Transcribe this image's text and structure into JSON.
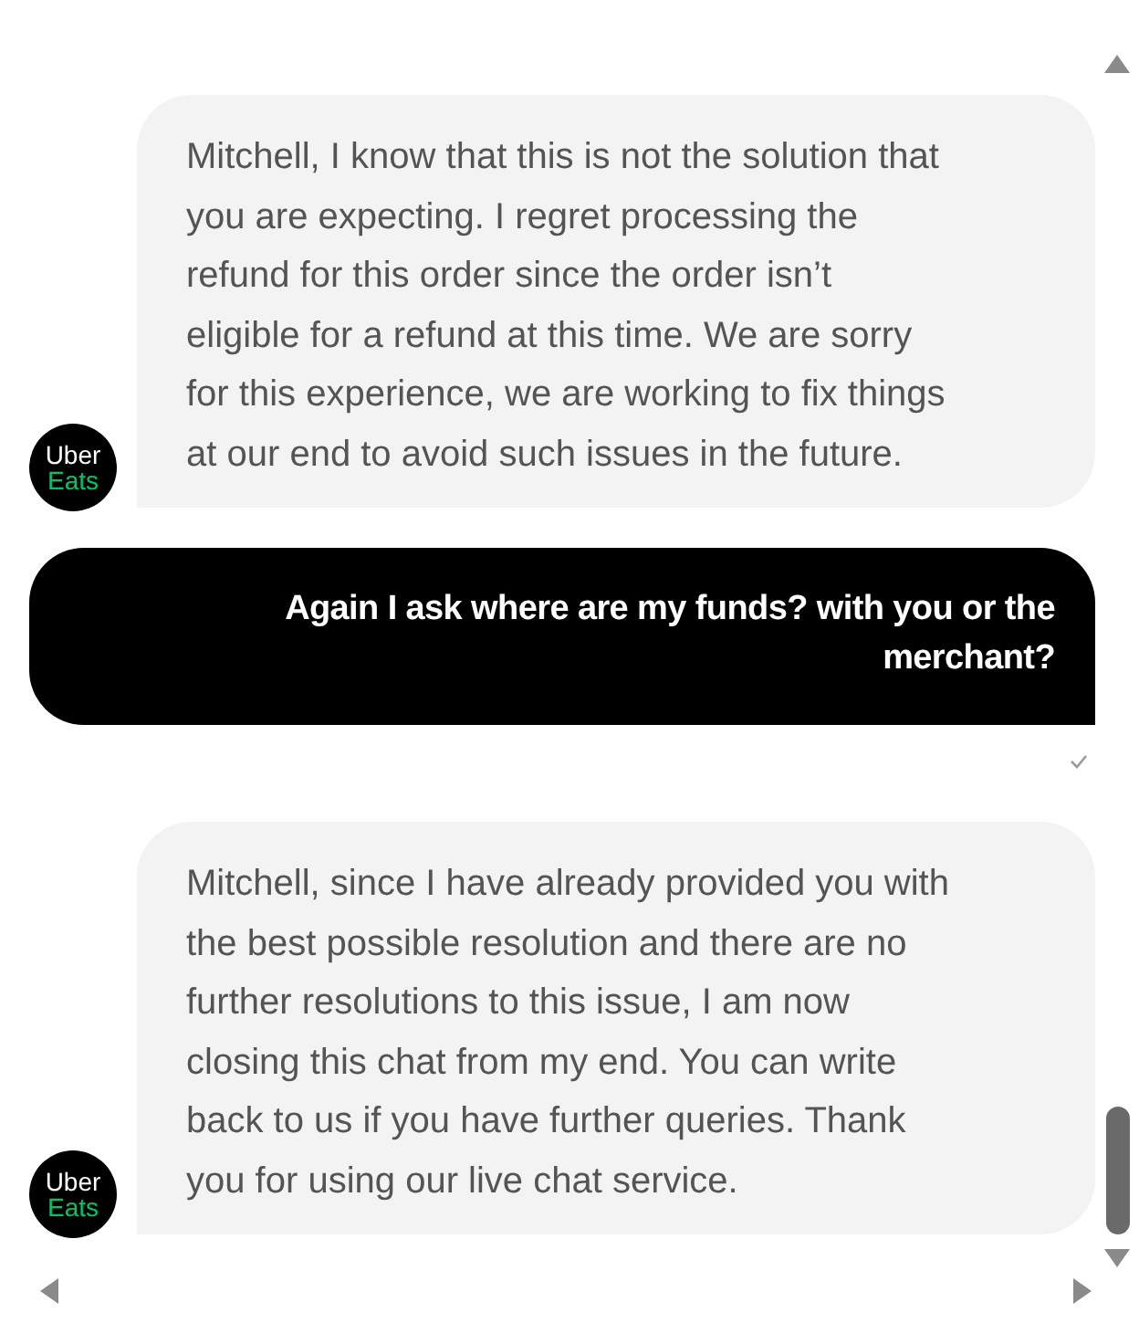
{
  "messages": [
    {
      "kind": "agent",
      "avatar": [
        "Uber",
        "Eats"
      ],
      "lines": [
        "Mitchell, I know that this is not the solution that",
        "you are expecting. I regret processing the",
        "refund for this order since the order isn’t",
        "eligible for a refund at this time. We are sorry",
        "for this experience, we are working to fix things",
        "at our end to avoid such issues in the future."
      ]
    },
    {
      "kind": "user",
      "lines": [
        "Again I ask where are my funds? with you or the",
        "merchant?"
      ],
      "delivered": true
    },
    {
      "kind": "agent",
      "avatar": [
        "Uber",
        "Eats"
      ],
      "lines": [
        "Mitchell, since I have already provided you with",
        "the best possible resolution and there are no",
        "further resolutions to this issue, I am now",
        "closing this chat from my end. You can write",
        "back to us if you have further queries. Thank",
        "you for using our live chat service."
      ]
    }
  ]
}
